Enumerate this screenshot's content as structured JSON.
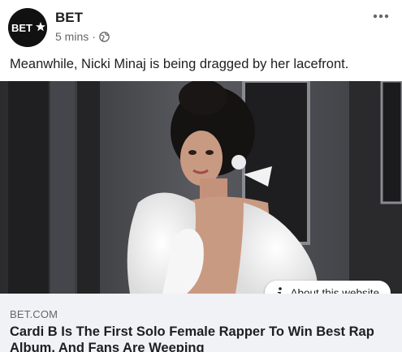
{
  "post": {
    "page_name": "BET",
    "timestamp": "5 mins",
    "separator": "·",
    "caption": "Meanwhile, Nicki Minaj is being dragged by her lacefront.",
    "avatar_icon": "bet-logo-icon",
    "audience_icon": "globe-icon",
    "menu_icon": "more-options-icon"
  },
  "image": {
    "about_label": "About this website",
    "about_icon": "info-icon"
  },
  "link": {
    "domain": "BET.COM",
    "headline": "Cardi B Is The First Solo Female Rapper To Win Best Rap Album. And Fans Are Weeping"
  },
  "colors": {
    "text_primary": "#1c1e21",
    "text_secondary": "#65676b",
    "link_background": "#f0f2f5"
  }
}
